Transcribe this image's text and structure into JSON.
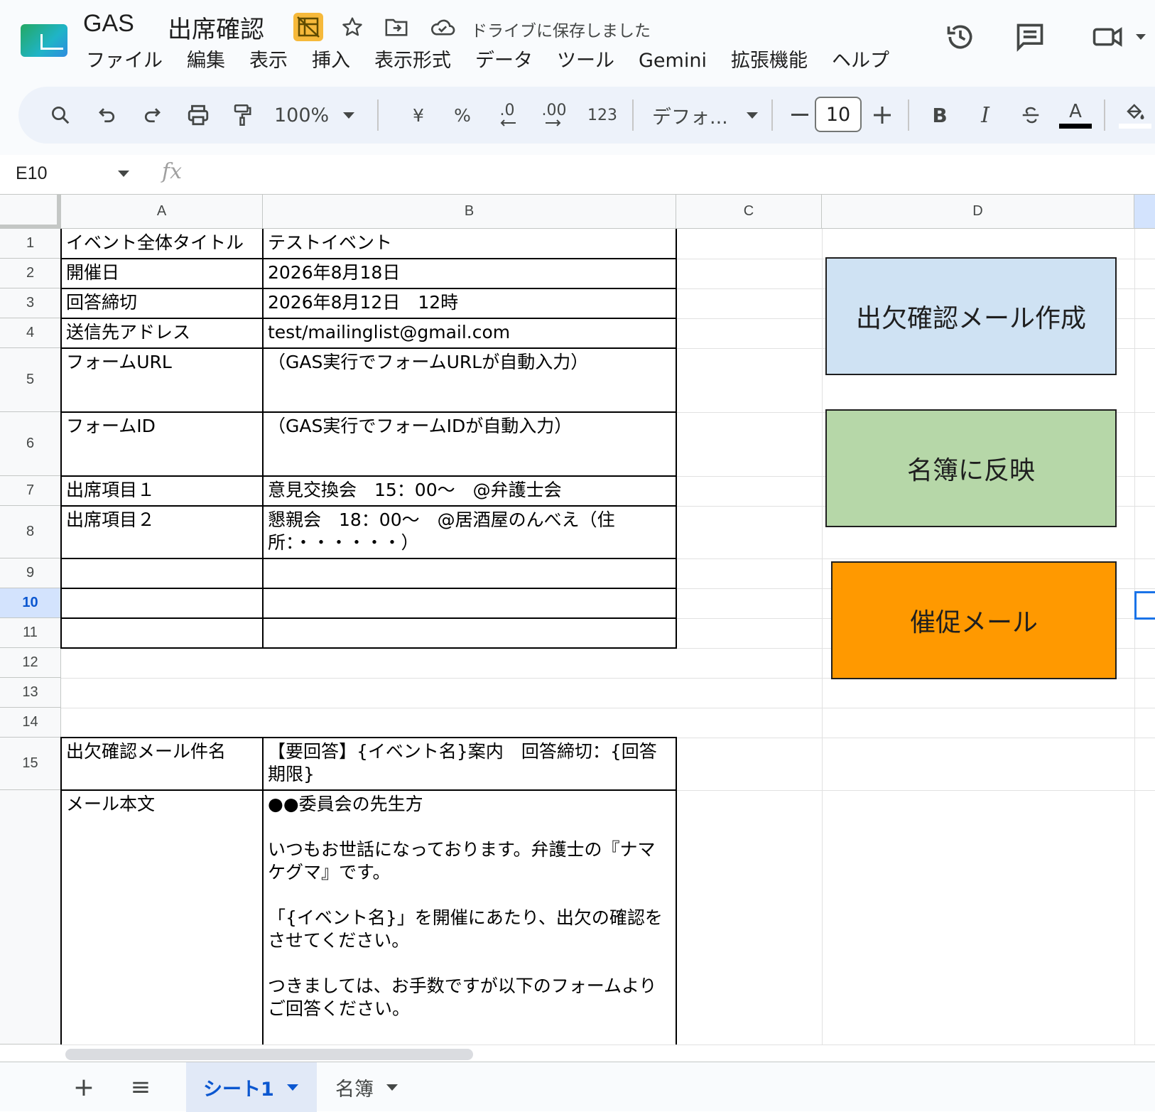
{
  "doc": {
    "app_title": "GAS",
    "file_title": "出席確認",
    "save_status": "ドライブに保存しました"
  },
  "menu": [
    "ファイル",
    "編集",
    "表示",
    "挿入",
    "表示形式",
    "データ",
    "ツール",
    "Gemini",
    "拡張機能",
    "ヘルプ"
  ],
  "toolbar": {
    "zoom": "100%",
    "currency": "¥",
    "percent": "%",
    "dec_decrease": ".0",
    "dec_increase": ".00",
    "number_format": "123",
    "font": "デフォ...",
    "font_size": "10",
    "bold": "B",
    "italic": "I",
    "text_color": "A"
  },
  "formula_bar": {
    "cell_ref": "E10",
    "fx": "fx",
    "formula": ""
  },
  "columns": [
    "A",
    "B",
    "C",
    "D"
  ],
  "rows": [
    "1",
    "2",
    "3",
    "4",
    "5",
    "6",
    "7",
    "8",
    "9",
    "10",
    "11",
    "12",
    "13",
    "14",
    "15"
  ],
  "active_row": "10",
  "cells": {
    "A1": "イベント全体タイトル",
    "B1": "テストイベント",
    "A2": "開催日",
    "B2": "2026年8月18日",
    "A3": "回答締切",
    "B3": "2026年8月12日　12時",
    "A4": "送信先アドレス",
    "B4": "test/mailinglist@gmail.com",
    "A5": "フォームURL",
    "B5": "（GAS実行でフォームURLが自動入力）",
    "A6": "フォームID",
    "B6": "（GAS実行でフォームIDが自動入力）",
    "A7": "出席項目１",
    "B7": "意見交換会　15：00〜　@弁護士会",
    "A8": "出席項目２",
    "B8": "懇親会　18：00〜　@居酒屋のんべえ（住所：・・・・・・）",
    "A15": "出欠確認メール件名",
    "B15": "【要回答】{イベント名}案内　回答締切：{回答期限}",
    "A16": "メール本文",
    "B16": "●●委員会の先生方\n\nいつもお世話になっております。弁護士の『ナマケグマ』です。\n\n「{イベント名}」を開催にあたり、出欠の確認をさせてください。\n\nつきましては、お手数ですが以下のフォームよりご回答ください。"
  },
  "drawing_buttons": [
    {
      "label": "出欠確認メール作成",
      "color": "#cfe2f3"
    },
    {
      "label": "名簿に反映",
      "color": "#b6d7a8"
    },
    {
      "label": "催促メール",
      "color": "#ff9900"
    }
  ],
  "sheets": {
    "add": "+",
    "list": "≡",
    "tabs": [
      "シート1",
      "名簿"
    ],
    "active": "シート1"
  }
}
